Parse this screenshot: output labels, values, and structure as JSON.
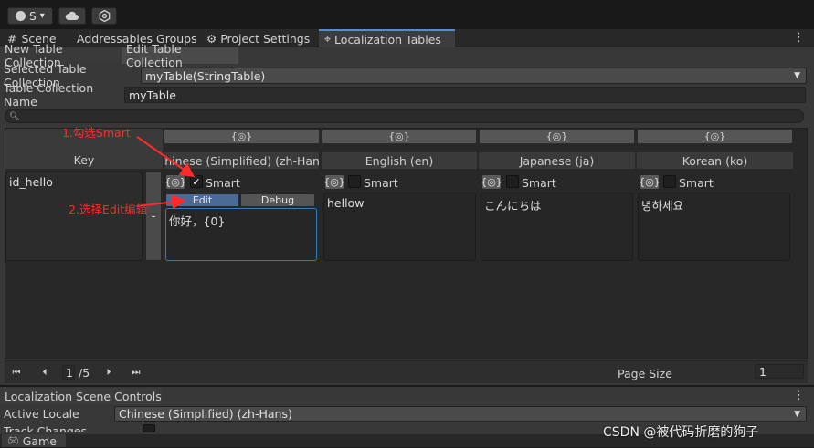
{
  "toolbar": {
    "account_label": "S",
    "account_caret": "▾",
    "cloud_icon": "cloud-icon",
    "settings_icon": "settings-gear-icon"
  },
  "tabs": {
    "scene": "Scene",
    "addressables": "Addressables Groups",
    "project_settings": "Project Settings",
    "localization": "Localization Tables",
    "menu": "⋮"
  },
  "window": {
    "subtabs": {
      "new": "New Table Collection",
      "edit": "Edit Table Collection"
    },
    "selected_label": "Selected Table Collection",
    "selected_value": "myTable(StringTable)",
    "name_label": "Table Collection Name",
    "name_value": "myTable",
    "search_placeholder": ""
  },
  "table": {
    "key_header": "Key",
    "locale_headers": [
      "Chinese (Simplified) (zh-Hans",
      "English (en)",
      "Japanese (ja)",
      "Korean (ko)"
    ],
    "row_key": "id_hello",
    "remove_button": "-",
    "smart_label": "Smart",
    "smart_checked": [
      true,
      false,
      false,
      false
    ],
    "edit_tab": "Edit",
    "debug_tab": "Debug",
    "values": [
      "你好，{0}",
      "hellow",
      "こんにちは",
      "녕하세요"
    ]
  },
  "annotations": {
    "step1": "1.勾选Smart",
    "step2": "2.选择Edit编辑",
    "color": "#ff2a2a"
  },
  "pager": {
    "current_page": "1",
    "total_pages": "/5",
    "page_size_label": "Page Size",
    "page_size_value": "1"
  },
  "scene_controls": {
    "title": "Localization Scene Controls",
    "active_locale_label": "Active Locale",
    "active_locale_value": "Chinese (Simplified) (zh-Hans)",
    "track_changes_label": "Track Changes"
  },
  "game_tab": "Game",
  "watermark": "CSDN @被代码折磨的狗子"
}
